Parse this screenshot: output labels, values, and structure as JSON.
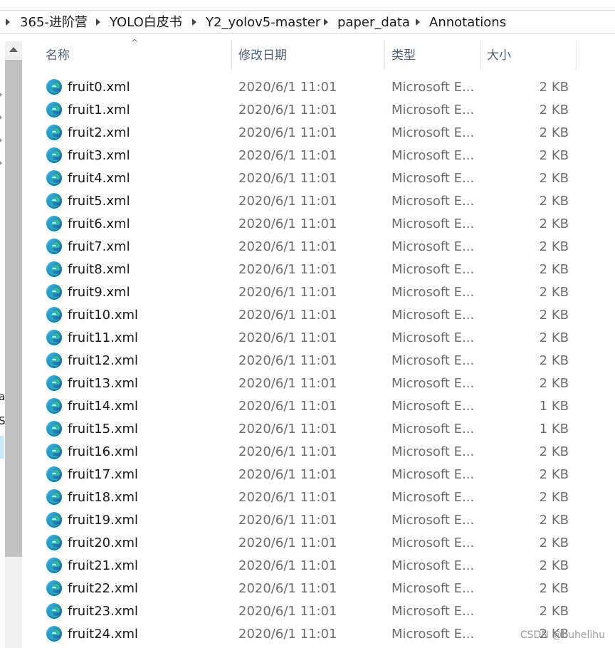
{
  "breadcrumb": {
    "items": [
      "365-进阶营",
      "YOLO白皮书",
      "Y2_yolov5-master",
      "paper_data",
      "Annotations"
    ]
  },
  "nav_fragments": [
    "a",
    "S"
  ],
  "columns": {
    "name": "名称",
    "date": "修改日期",
    "type": "类型",
    "size": "大小"
  },
  "sort": {
    "column": "name",
    "direction": "ascending"
  },
  "files": [
    {
      "name": "fruit0.xml",
      "date": "2020/6/1 11:01",
      "type": "Microsoft E...",
      "size": "2 KB"
    },
    {
      "name": "fruit1.xml",
      "date": "2020/6/1 11:01",
      "type": "Microsoft E...",
      "size": "2 KB"
    },
    {
      "name": "fruit2.xml",
      "date": "2020/6/1 11:01",
      "type": "Microsoft E...",
      "size": "2 KB"
    },
    {
      "name": "fruit3.xml",
      "date": "2020/6/1 11:01",
      "type": "Microsoft E...",
      "size": "2 KB"
    },
    {
      "name": "fruit4.xml",
      "date": "2020/6/1 11:01",
      "type": "Microsoft E...",
      "size": "2 KB"
    },
    {
      "name": "fruit5.xml",
      "date": "2020/6/1 11:01",
      "type": "Microsoft E...",
      "size": "2 KB"
    },
    {
      "name": "fruit6.xml",
      "date": "2020/6/1 11:01",
      "type": "Microsoft E...",
      "size": "2 KB"
    },
    {
      "name": "fruit7.xml",
      "date": "2020/6/1 11:01",
      "type": "Microsoft E...",
      "size": "2 KB"
    },
    {
      "name": "fruit8.xml",
      "date": "2020/6/1 11:01",
      "type": "Microsoft E...",
      "size": "2 KB"
    },
    {
      "name": "fruit9.xml",
      "date": "2020/6/1 11:01",
      "type": "Microsoft E...",
      "size": "2 KB"
    },
    {
      "name": "fruit10.xml",
      "date": "2020/6/1 11:01",
      "type": "Microsoft E...",
      "size": "2 KB"
    },
    {
      "name": "fruit11.xml",
      "date": "2020/6/1 11:01",
      "type": "Microsoft E...",
      "size": "2 KB"
    },
    {
      "name": "fruit12.xml",
      "date": "2020/6/1 11:01",
      "type": "Microsoft E...",
      "size": "2 KB"
    },
    {
      "name": "fruit13.xml",
      "date": "2020/6/1 11:01",
      "type": "Microsoft E...",
      "size": "2 KB"
    },
    {
      "name": "fruit14.xml",
      "date": "2020/6/1 11:01",
      "type": "Microsoft E...",
      "size": "1 KB"
    },
    {
      "name": "fruit15.xml",
      "date": "2020/6/1 11:01",
      "type": "Microsoft E...",
      "size": "1 KB"
    },
    {
      "name": "fruit16.xml",
      "date": "2020/6/1 11:01",
      "type": "Microsoft E...",
      "size": "2 KB"
    },
    {
      "name": "fruit17.xml",
      "date": "2020/6/1 11:01",
      "type": "Microsoft E...",
      "size": "2 KB"
    },
    {
      "name": "fruit18.xml",
      "date": "2020/6/1 11:01",
      "type": "Microsoft E...",
      "size": "2 KB"
    },
    {
      "name": "fruit19.xml",
      "date": "2020/6/1 11:01",
      "type": "Microsoft E...",
      "size": "2 KB"
    },
    {
      "name": "fruit20.xml",
      "date": "2020/6/1 11:01",
      "type": "Microsoft E...",
      "size": "2 KB"
    },
    {
      "name": "fruit21.xml",
      "date": "2020/6/1 11:01",
      "type": "Microsoft E...",
      "size": "2 KB"
    },
    {
      "name": "fruit22.xml",
      "date": "2020/6/1 11:01",
      "type": "Microsoft E...",
      "size": "2 KB"
    },
    {
      "name": "fruit23.xml",
      "date": "2020/6/1 11:01",
      "type": "Microsoft E...",
      "size": "2 KB"
    },
    {
      "name": "fruit24.xml",
      "date": "2020/6/1 11:01",
      "type": "Microsoft E...",
      "size": "2 KB"
    }
  ],
  "file_icon": "edge-browser-icon",
  "watermark": "CSDN @huhelihu",
  "colors": {
    "header_text": "#4c607a",
    "meta_text": "#6d6d6d",
    "selection": "#cce8ff",
    "edge_blue": "#1b73d3",
    "edge_green": "#3ac47d"
  }
}
